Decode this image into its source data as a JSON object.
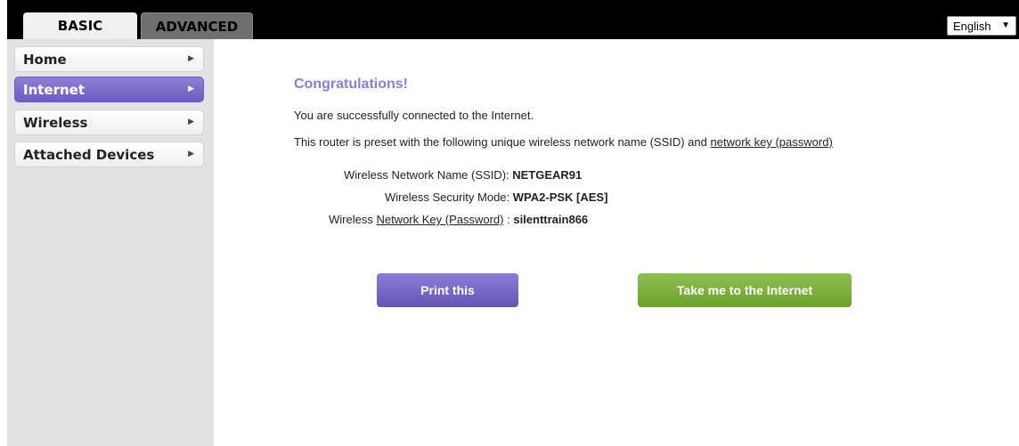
{
  "tabs": {
    "basic": "BASIC",
    "advanced": "ADVANCED"
  },
  "language": {
    "selected": "English"
  },
  "sidebar": {
    "items": [
      {
        "label": "Home"
      },
      {
        "label": "Internet"
      },
      {
        "label": "Wireless"
      },
      {
        "label": "Attached Devices"
      }
    ]
  },
  "main": {
    "title": "Congratulations!",
    "line1": "You are successfully connected to the Internet.",
    "line2_prefix": "This router is preset with the following unique wireless network name (SSID) and ",
    "line2_link": "network key (password)",
    "ssid_label": "Wireless Network Name (SSID): ",
    "ssid_value": "NETGEAR91",
    "security_label": "Wireless Security Mode: ",
    "security_value": "WPA2-PSK [AES]",
    "key_prefix": "Wireless ",
    "key_link": "Network Key (Password)",
    "key_sep": " : ",
    "key_value": "silenttrain866",
    "print_button": "Print this",
    "go_button": "Take me to the Internet"
  },
  "colors": {
    "accent_purple": "#7b6bd0",
    "accent_green": "#7bb33a"
  }
}
